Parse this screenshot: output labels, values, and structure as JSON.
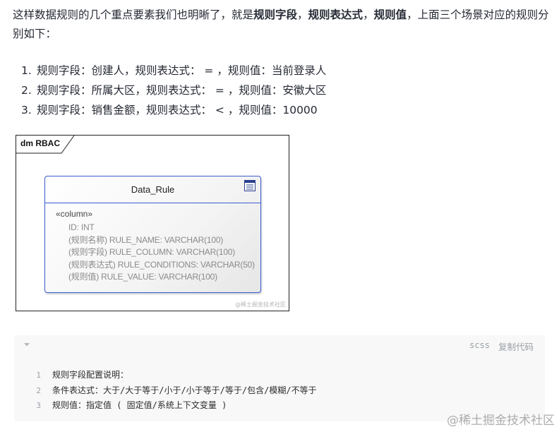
{
  "intro": {
    "part1": "这样数据规则的几个重点要素我们也明晰了，就是",
    "bold1": "规则字段",
    "sep1": "，",
    "bold2": "规则表达式",
    "sep2": "，",
    "bold3": "规则值",
    "part2": "，上面三个场景对应的规则分别如下："
  },
  "rules": [
    {
      "num": "1.",
      "text": "规则字段：创建人，规则表达式： = ，规则值：当前登录人"
    },
    {
      "num": "2.",
      "text": "规则字段：所属大区，规则表达式： = ，规则值：安徽大区"
    },
    {
      "num": "3.",
      "text": "规则字段：销售金额，规则表达式： < ，规则值：10000"
    }
  ],
  "diagram": {
    "tab_label": "dm RBAC",
    "entity_name": "Data_Rule",
    "stereotype": "«column»",
    "columns": [
      "ID: INT",
      "(规则名称) RULE_NAME: VARCHAR(100)",
      "(规则字段) RULE_COLUMN: VARCHAR(100)",
      "(规则表达式) RULE_CONDITIONS: VARCHAR(50)",
      "(规则值) RULE_VALUE: VARCHAR(100)"
    ],
    "watermark": "@稀土掘金技术社区",
    "icon": "table-icon"
  },
  "code": {
    "language": "scss",
    "copy_label": "复制代码",
    "lines": [
      {
        "n": "1",
        "text": "规则字段配置说明："
      },
      {
        "n": "2",
        "text": "条件表达式：大于/大于等于/小于/小于等于/等于/包含/模糊/不等于"
      },
      {
        "n": "3",
        "text": "规则值：指定值 ( 固定值/系统上下文变量 )"
      }
    ]
  },
  "watermark": "@稀土掘金技术社区"
}
